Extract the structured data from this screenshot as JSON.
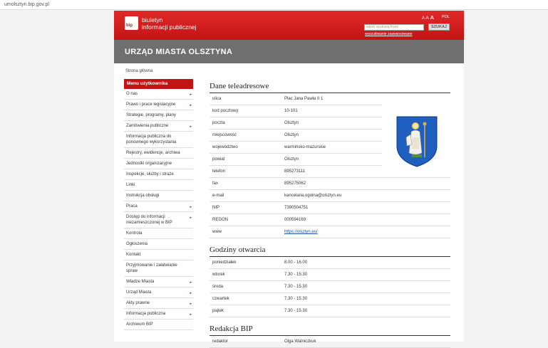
{
  "browser": {
    "url": "umolsztyn.bip.gov.pl"
  },
  "header": {
    "logo_mark": "bip",
    "logo_line1": "biuletyn",
    "logo_line2": "informacji publicznej",
    "font_a_small": "A",
    "font_a_mid": "A",
    "font_a_large": "A",
    "lang": "POL",
    "search_placeholder": "wpisz szukaną frazę",
    "search_button": "SZUKAJ",
    "advanced_search": "wyszukiwanie zaawansowane"
  },
  "title": "URZĄD MIASTA OLSZTYNA",
  "breadcrumb": "Strona główna",
  "menu": {
    "header": "Menu użytkownika",
    "items": [
      {
        "label": "O nas",
        "arrow": "▸"
      },
      {
        "label": "Prawo i prace legislacyjne",
        "arrow": "▸"
      },
      {
        "label": "Strategie, programy, plany",
        "arrow": ""
      },
      {
        "label": "Zamówienia publiczne",
        "arrow": "▸"
      },
      {
        "label": "Informacja publiczna do ponownego wykorzystania",
        "arrow": ""
      },
      {
        "label": "Rejestry, ewidencje, archiwa",
        "arrow": ""
      },
      {
        "label": "Jednostki organizacyjne",
        "arrow": ""
      },
      {
        "label": "Inspekcje, służby i straże",
        "arrow": ""
      },
      {
        "label": "Linki",
        "arrow": ""
      },
      {
        "label": "Instrukcja obsługi",
        "arrow": ""
      },
      {
        "label": "Praca",
        "arrow": "▸"
      },
      {
        "label": "Dostęp do informacji niezamieszczonej w BIP",
        "arrow": "▸"
      },
      {
        "label": "Kontrola",
        "arrow": ""
      },
      {
        "label": "Ogłoszenia",
        "arrow": ""
      },
      {
        "label": "Kontakt",
        "arrow": ""
      },
      {
        "label": "Przyjmowanie i załatwianie spraw",
        "arrow": ""
      },
      {
        "label": "Władze Miasta",
        "arrow": "▸"
      },
      {
        "label": "Urząd Miasta",
        "arrow": "▸"
      },
      {
        "label": "Akty prawne",
        "arrow": "▸"
      },
      {
        "label": "Informacja publiczna",
        "arrow": "▸"
      },
      {
        "label": "Archiwum BIP",
        "arrow": ""
      }
    ]
  },
  "contact": {
    "title": "Dane teleadresowe",
    "rows": [
      {
        "key": "ulica",
        "value": "Plac Jana Pawła II 1"
      },
      {
        "key": "kod pocztowy",
        "value": "10-101"
      },
      {
        "key": "poczta",
        "value": "Olsztyn"
      },
      {
        "key": "miejscowość",
        "value": "Olsztyn"
      },
      {
        "key": "województwo",
        "value": "warmińsko-mazurskie"
      },
      {
        "key": "powiat",
        "value": "Olsztyn"
      },
      {
        "key": "telefon",
        "value": "895273111"
      },
      {
        "key": "fax",
        "value": "895275062"
      },
      {
        "key": "e-mail",
        "value": "kancelaria.ogolna@olsztyn.eu"
      },
      {
        "key": "NIP",
        "value": "7390504751"
      },
      {
        "key": "REGON",
        "value": "000594169"
      },
      {
        "key": "www",
        "value": "https://olsztyn.eu/"
      }
    ]
  },
  "hours": {
    "title": "Godziny otwarcia",
    "rows": [
      {
        "key": "poniedziałek",
        "value": "8.00 - 16.00"
      },
      {
        "key": "wtorek",
        "value": "7.30 - 15.30"
      },
      {
        "key": "środa",
        "value": "7.30 - 15.30"
      },
      {
        "key": "czwartek",
        "value": "7.30 - 15.30"
      },
      {
        "key": "piątek",
        "value": "7.30 - 15.30"
      }
    ]
  },
  "editorial": {
    "title": "Redakcja BIP",
    "rows": [
      {
        "key": "redaktor",
        "value": "Olga Walniczkuk"
      }
    ]
  },
  "colors": {
    "brand_red": "#c41313",
    "band_gray": "#6f6f6f",
    "link_blue": "#1a4fa0",
    "crest_blue": "#1f5fbf"
  }
}
